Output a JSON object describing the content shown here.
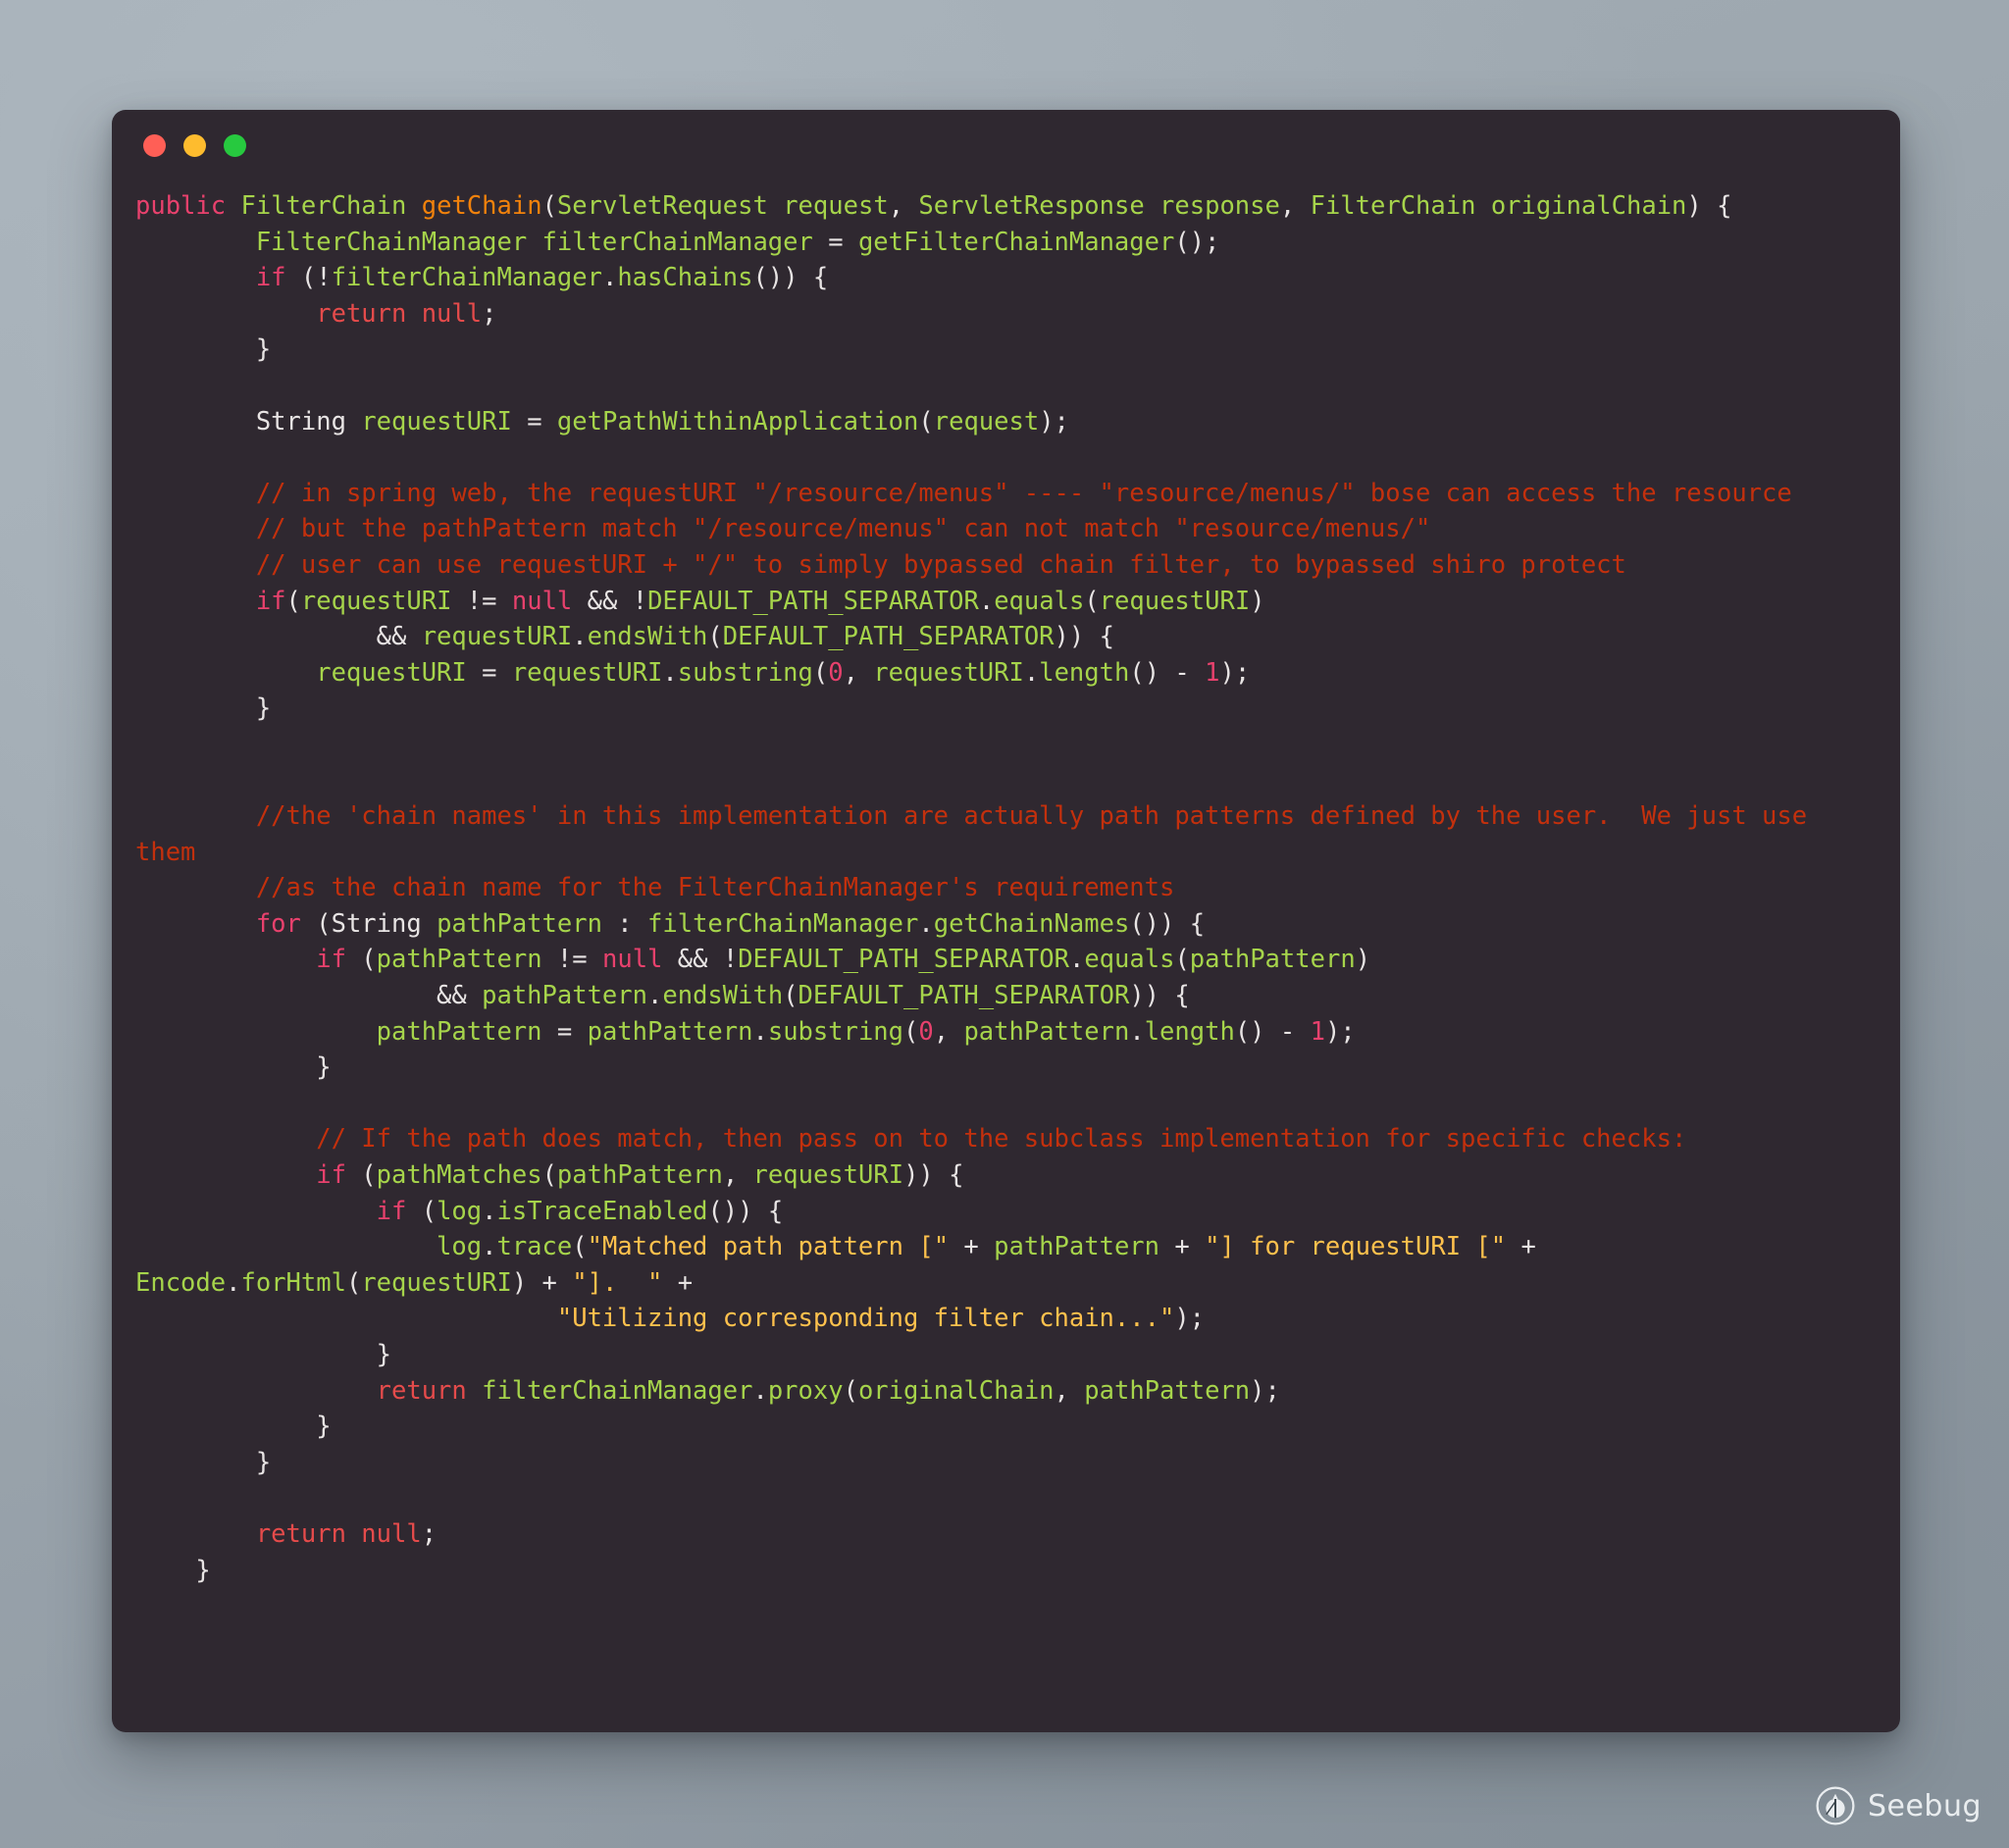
{
  "window": {
    "traffic_lights": [
      {
        "name": "close",
        "color": "#ff5f56"
      },
      {
        "name": "minimize",
        "color": "#febc2e"
      },
      {
        "name": "maximize",
        "color": "#27c93f"
      }
    ]
  },
  "theme": {
    "background": "#2f2830",
    "desktop": "#9aa5ad",
    "text": "#e8e4e4",
    "keyword": "#e8416d",
    "keyword_return": "#e54b4b",
    "identifier": "#a6d44b",
    "function": "#f2820c",
    "comment": "#c3300d",
    "string": "#ffc14d",
    "number": "#e8416d"
  },
  "watermark": {
    "label": "Seebug",
    "icon": "bug-icon"
  },
  "code": {
    "language": "java",
    "lines": [
      [
        {
          "t": "public",
          "c": "kw"
        },
        {
          "t": " ",
          "c": "pl"
        },
        {
          "t": "FilterChain",
          "c": "type"
        },
        {
          "t": " ",
          "c": "pl"
        },
        {
          "t": "getChain",
          "c": "fn"
        },
        {
          "t": "(",
          "c": "pl"
        },
        {
          "t": "ServletRequest request",
          "c": "type"
        },
        {
          "t": ", ",
          "c": "pl"
        },
        {
          "t": "ServletResponse response",
          "c": "type"
        },
        {
          "t": ", ",
          "c": "pl"
        },
        {
          "t": "FilterChain originalChain",
          "c": "type"
        },
        {
          "t": ") {",
          "c": "pl"
        }
      ],
      [
        {
          "t": "        FilterChainManager filterChainManager",
          "c": "type"
        },
        {
          "t": " = ",
          "c": "pl"
        },
        {
          "t": "getFilterChainManager",
          "c": "type"
        },
        {
          "t": "();",
          "c": "pl"
        }
      ],
      [
        {
          "t": "        ",
          "c": "pl"
        },
        {
          "t": "if",
          "c": "kw"
        },
        {
          "t": " (!",
          "c": "pl"
        },
        {
          "t": "filterChainManager",
          "c": "type"
        },
        {
          "t": ".",
          "c": "pl"
        },
        {
          "t": "hasChains",
          "c": "type"
        },
        {
          "t": "()) {",
          "c": "pl"
        }
      ],
      [
        {
          "t": "            ",
          "c": "pl"
        },
        {
          "t": "return null",
          "c": "kw-red"
        },
        {
          "t": ";",
          "c": "pl"
        }
      ],
      [
        {
          "t": "        }",
          "c": "pl"
        }
      ],
      [
        {
          "t": "",
          "c": "pl"
        }
      ],
      [
        {
          "t": "        String",
          "c": "pl"
        },
        {
          "t": " ",
          "c": "pl"
        },
        {
          "t": "requestURI",
          "c": "type"
        },
        {
          "t": " = ",
          "c": "pl"
        },
        {
          "t": "getPathWithinApplication",
          "c": "type"
        },
        {
          "t": "(",
          "c": "pl"
        },
        {
          "t": "request",
          "c": "type"
        },
        {
          "t": ");",
          "c": "pl"
        }
      ],
      [
        {
          "t": "",
          "c": "pl"
        }
      ],
      [
        {
          "t": "        // in spring web, the requestURI \"/resource/menus\" ---- \"resource/menus/\" bose can access the resource",
          "c": "cm"
        }
      ],
      [
        {
          "t": "        // but the pathPattern match \"/resource/menus\" can not match \"resource/menus/\"",
          "c": "cm"
        }
      ],
      [
        {
          "t": "        // user can use requestURI + \"/\" to simply bypassed chain filter, to bypassed shiro protect",
          "c": "cm"
        }
      ],
      [
        {
          "t": "        ",
          "c": "pl"
        },
        {
          "t": "if",
          "c": "kw"
        },
        {
          "t": "(",
          "c": "pl"
        },
        {
          "t": "requestURI",
          "c": "type"
        },
        {
          "t": " != ",
          "c": "pl"
        },
        {
          "t": "null",
          "c": "kw"
        },
        {
          "t": " && ",
          "c": "pl"
        },
        {
          "t": "!",
          "c": "pl"
        },
        {
          "t": "DEFAULT_PATH_SEPARATOR",
          "c": "type"
        },
        {
          "t": ".",
          "c": "pl"
        },
        {
          "t": "equals",
          "c": "type"
        },
        {
          "t": "(",
          "c": "pl"
        },
        {
          "t": "requestURI",
          "c": "type"
        },
        {
          "t": ")",
          "c": "pl"
        }
      ],
      [
        {
          "t": "                && ",
          "c": "pl"
        },
        {
          "t": "requestURI",
          "c": "type"
        },
        {
          "t": ".",
          "c": "pl"
        },
        {
          "t": "endsWith",
          "c": "type"
        },
        {
          "t": "(",
          "c": "pl"
        },
        {
          "t": "DEFAULT_PATH_SEPARATOR",
          "c": "type"
        },
        {
          "t": ")) {",
          "c": "pl"
        }
      ],
      [
        {
          "t": "            ",
          "c": "pl"
        },
        {
          "t": "requestURI",
          "c": "type"
        },
        {
          "t": " = ",
          "c": "pl"
        },
        {
          "t": "requestURI",
          "c": "type"
        },
        {
          "t": ".",
          "c": "pl"
        },
        {
          "t": "substring",
          "c": "type"
        },
        {
          "t": "(",
          "c": "pl"
        },
        {
          "t": "0",
          "c": "num"
        },
        {
          "t": ", ",
          "c": "pl"
        },
        {
          "t": "requestURI",
          "c": "type"
        },
        {
          "t": ".",
          "c": "pl"
        },
        {
          "t": "length",
          "c": "type"
        },
        {
          "t": "() - ",
          "c": "pl"
        },
        {
          "t": "1",
          "c": "num"
        },
        {
          "t": ");",
          "c": "pl"
        }
      ],
      [
        {
          "t": "        }",
          "c": "pl"
        }
      ],
      [
        {
          "t": "",
          "c": "pl"
        }
      ],
      [
        {
          "t": "",
          "c": "pl"
        }
      ],
      [
        {
          "t": "        //the 'chain names' in this implementation are actually path patterns defined by the user.  We just use them",
          "c": "cm"
        }
      ],
      [
        {
          "t": "        //as the chain name for the FilterChainManager's requirements",
          "c": "cm"
        }
      ],
      [
        {
          "t": "        ",
          "c": "pl"
        },
        {
          "t": "for",
          "c": "kw"
        },
        {
          "t": " (String ",
          "c": "pl"
        },
        {
          "t": "pathPattern",
          "c": "type"
        },
        {
          "t": " : ",
          "c": "pl"
        },
        {
          "t": "filterChainManager",
          "c": "type"
        },
        {
          "t": ".",
          "c": "pl"
        },
        {
          "t": "getChainNames",
          "c": "type"
        },
        {
          "t": "()) {",
          "c": "pl"
        }
      ],
      [
        {
          "t": "            ",
          "c": "pl"
        },
        {
          "t": "if",
          "c": "kw"
        },
        {
          "t": " (",
          "c": "pl"
        },
        {
          "t": "pathPattern",
          "c": "type"
        },
        {
          "t": " != ",
          "c": "pl"
        },
        {
          "t": "null",
          "c": "kw"
        },
        {
          "t": " && ",
          "c": "pl"
        },
        {
          "t": "!",
          "c": "pl"
        },
        {
          "t": "DEFAULT_PATH_SEPARATOR",
          "c": "type"
        },
        {
          "t": ".",
          "c": "pl"
        },
        {
          "t": "equals",
          "c": "type"
        },
        {
          "t": "(",
          "c": "pl"
        },
        {
          "t": "pathPattern",
          "c": "type"
        },
        {
          "t": ")",
          "c": "pl"
        }
      ],
      [
        {
          "t": "                    && ",
          "c": "pl"
        },
        {
          "t": "pathPattern",
          "c": "type"
        },
        {
          "t": ".",
          "c": "pl"
        },
        {
          "t": "endsWith",
          "c": "type"
        },
        {
          "t": "(",
          "c": "pl"
        },
        {
          "t": "DEFAULT_PATH_SEPARATOR",
          "c": "type"
        },
        {
          "t": ")) {",
          "c": "pl"
        }
      ],
      [
        {
          "t": "                ",
          "c": "pl"
        },
        {
          "t": "pathPattern",
          "c": "type"
        },
        {
          "t": " = ",
          "c": "pl"
        },
        {
          "t": "pathPattern",
          "c": "type"
        },
        {
          "t": ".",
          "c": "pl"
        },
        {
          "t": "substring",
          "c": "type"
        },
        {
          "t": "(",
          "c": "pl"
        },
        {
          "t": "0",
          "c": "num"
        },
        {
          "t": ", ",
          "c": "pl"
        },
        {
          "t": "pathPattern",
          "c": "type"
        },
        {
          "t": ".",
          "c": "pl"
        },
        {
          "t": "length",
          "c": "type"
        },
        {
          "t": "() - ",
          "c": "pl"
        },
        {
          "t": "1",
          "c": "num"
        },
        {
          "t": ");",
          "c": "pl"
        }
      ],
      [
        {
          "t": "            }",
          "c": "pl"
        }
      ],
      [
        {
          "t": "",
          "c": "pl"
        }
      ],
      [
        {
          "t": "            // If the path does match, then pass on to the subclass implementation for specific checks:",
          "c": "cm"
        }
      ],
      [
        {
          "t": "            ",
          "c": "pl"
        },
        {
          "t": "if",
          "c": "kw"
        },
        {
          "t": " (",
          "c": "pl"
        },
        {
          "t": "pathMatches",
          "c": "type"
        },
        {
          "t": "(",
          "c": "pl"
        },
        {
          "t": "pathPattern",
          "c": "type"
        },
        {
          "t": ", ",
          "c": "pl"
        },
        {
          "t": "requestURI",
          "c": "type"
        },
        {
          "t": ")) {",
          "c": "pl"
        }
      ],
      [
        {
          "t": "                ",
          "c": "pl"
        },
        {
          "t": "if",
          "c": "kw"
        },
        {
          "t": " (",
          "c": "pl"
        },
        {
          "t": "log",
          "c": "type"
        },
        {
          "t": ".",
          "c": "pl"
        },
        {
          "t": "isTraceEnabled",
          "c": "type"
        },
        {
          "t": "()) {",
          "c": "pl"
        }
      ],
      [
        {
          "t": "                    ",
          "c": "pl"
        },
        {
          "t": "log",
          "c": "type"
        },
        {
          "t": ".",
          "c": "pl"
        },
        {
          "t": "trace",
          "c": "type"
        },
        {
          "t": "(",
          "c": "pl"
        },
        {
          "t": "\"Matched path pattern [\"",
          "c": "str"
        },
        {
          "t": " + ",
          "c": "pl"
        },
        {
          "t": "pathPattern",
          "c": "type"
        },
        {
          "t": " + ",
          "c": "pl"
        },
        {
          "t": "\"] for requestURI [\"",
          "c": "str"
        },
        {
          "t": " + ",
          "c": "pl"
        },
        {
          "t": "Encode",
          "c": "type"
        },
        {
          "t": ".",
          "c": "pl"
        },
        {
          "t": "forHtml",
          "c": "type"
        },
        {
          "t": "(",
          "c": "pl"
        },
        {
          "t": "requestURI",
          "c": "type"
        },
        {
          "t": ") + ",
          "c": "pl"
        },
        {
          "t": "\"].  \"",
          "c": "str"
        },
        {
          "t": " +",
          "c": "pl"
        }
      ],
      [
        {
          "t": "                            ",
          "c": "pl"
        },
        {
          "t": "\"Utilizing corresponding filter chain...\"",
          "c": "str"
        },
        {
          "t": ");",
          "c": "pl"
        }
      ],
      [
        {
          "t": "                }",
          "c": "pl"
        }
      ],
      [
        {
          "t": "                ",
          "c": "pl"
        },
        {
          "t": "return",
          "c": "kw-red"
        },
        {
          "t": " ",
          "c": "pl"
        },
        {
          "t": "filterChainManager",
          "c": "type"
        },
        {
          "t": ".",
          "c": "pl"
        },
        {
          "t": "proxy",
          "c": "type"
        },
        {
          "t": "(",
          "c": "pl"
        },
        {
          "t": "originalChain",
          "c": "type"
        },
        {
          "t": ", ",
          "c": "pl"
        },
        {
          "t": "pathPattern",
          "c": "type"
        },
        {
          "t": ");",
          "c": "pl"
        }
      ],
      [
        {
          "t": "            }",
          "c": "pl"
        }
      ],
      [
        {
          "t": "        }",
          "c": "pl"
        }
      ],
      [
        {
          "t": "",
          "c": "pl"
        }
      ],
      [
        {
          "t": "        ",
          "c": "pl"
        },
        {
          "t": "return null",
          "c": "kw-red"
        },
        {
          "t": ";",
          "c": "pl"
        }
      ],
      [
        {
          "t": "    }",
          "c": "pl"
        }
      ]
    ]
  }
}
